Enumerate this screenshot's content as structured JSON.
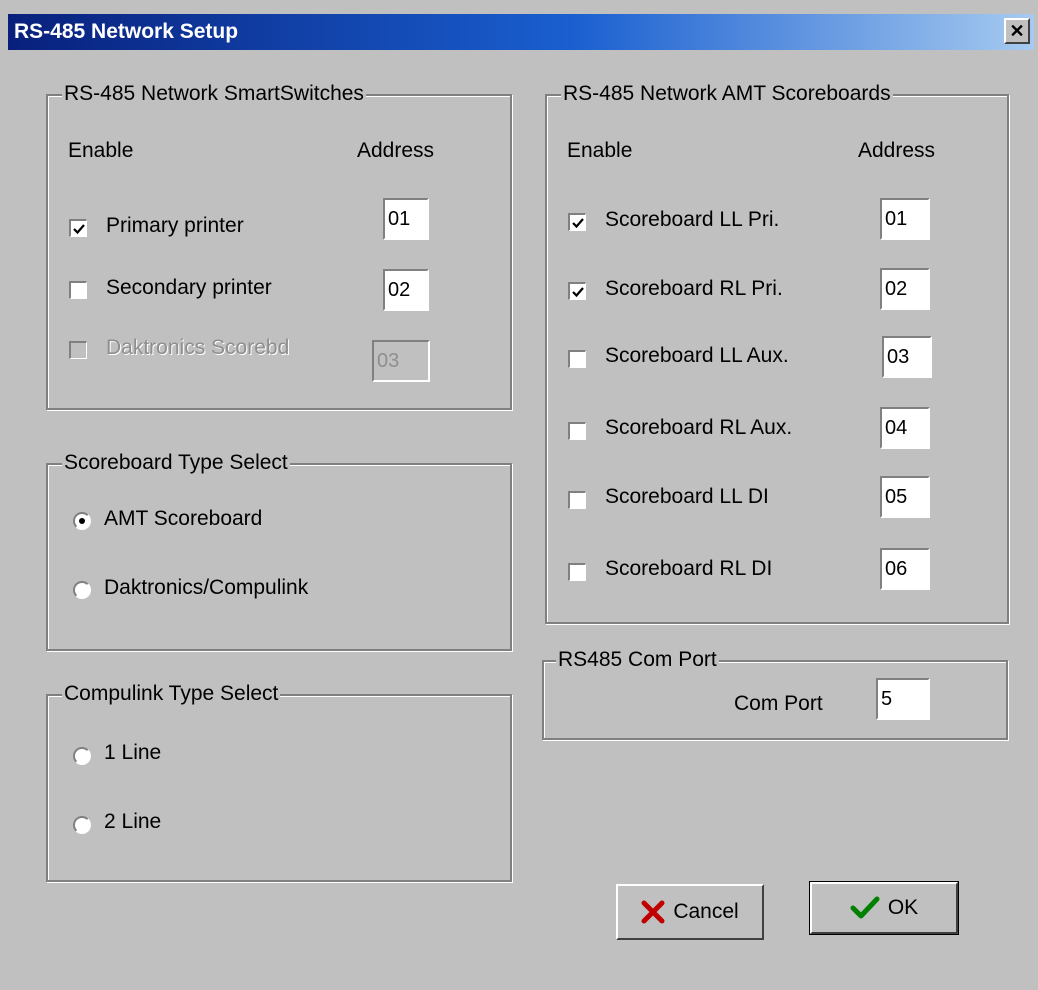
{
  "window": {
    "title": "RS-485 Network Setup",
    "close_glyph": "✕"
  },
  "smartswitches": {
    "title": "RS-485 Network SmartSwitches",
    "enable_header": "Enable",
    "address_header": "Address",
    "items": [
      {
        "label": "Primary printer",
        "checked": true,
        "address": "01",
        "enabled": true
      },
      {
        "label": "Secondary printer",
        "checked": false,
        "address": "02",
        "enabled": true
      },
      {
        "label": "Daktronics Scorebd",
        "checked": false,
        "address": "03",
        "enabled": false
      }
    ]
  },
  "scoreboard_type": {
    "title": "Scoreboard Type Select",
    "options": [
      {
        "label": "AMT Scoreboard",
        "selected": true
      },
      {
        "label": "Daktronics/Compulink",
        "selected": false
      }
    ]
  },
  "compulink_type": {
    "title": "Compulink Type Select",
    "options": [
      {
        "label": "1 Line",
        "selected": false
      },
      {
        "label": "2 Line",
        "selected": false
      }
    ]
  },
  "amt_scoreboards": {
    "title": "RS-485 Network AMT Scoreboards",
    "enable_header": "Enable",
    "address_header": "Address",
    "items": [
      {
        "label": "Scoreboard LL Pri.",
        "checked": true,
        "address": "01"
      },
      {
        "label": "Scoreboard RL Pri.",
        "checked": true,
        "address": "02"
      },
      {
        "label": "Scoreboard LL Aux.",
        "checked": false,
        "address": "03"
      },
      {
        "label": "Scoreboard RL Aux.",
        "checked": false,
        "address": "04"
      },
      {
        "label": "Scoreboard LL DI",
        "checked": false,
        "address": "05"
      },
      {
        "label": "Scoreboard RL DI",
        "checked": false,
        "address": "06"
      }
    ]
  },
  "com_port": {
    "title": "RS485 Com Port",
    "label": "Com Port",
    "value": "5"
  },
  "buttons": {
    "cancel_label": "Cancel",
    "ok_label": "OK",
    "cancel_icon": "x-mark-icon",
    "ok_icon": "checkmark-icon",
    "cancel_icon_color": "#c00000",
    "ok_icon_color": "#008000"
  },
  "colors": {
    "title_gradient_start": "#08207c",
    "title_gradient_end": "#a6caf0",
    "face": "#c0c0c0"
  }
}
